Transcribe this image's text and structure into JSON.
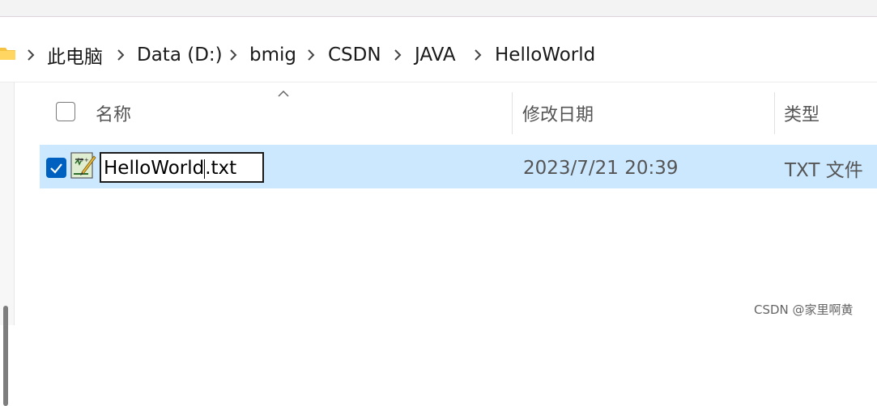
{
  "breadcrumb": {
    "items": [
      "此电脑",
      "Data (D:)",
      "bmig",
      "CSDN",
      "JAVA",
      "HelloWorld"
    ]
  },
  "columns": {
    "name": "名称",
    "modified": "修改日期",
    "type": "类型"
  },
  "file": {
    "name_selected": "HelloWorld",
    "name_ext": ".txt",
    "modified": "2023/7/21 20:39",
    "type": "TXT 文件",
    "checked": true
  },
  "icons": {
    "folder": "folder-icon",
    "chevron": "chevron-right-icon",
    "sort": "sort-up-icon",
    "file": "text-file-icon",
    "checkbox": "checkbox-icon"
  },
  "colors": {
    "selection": "#cce8ff",
    "checkbox_checked": "#0060c0",
    "folder": "#f5c242"
  },
  "watermark": "CSDN @家里啊黄"
}
